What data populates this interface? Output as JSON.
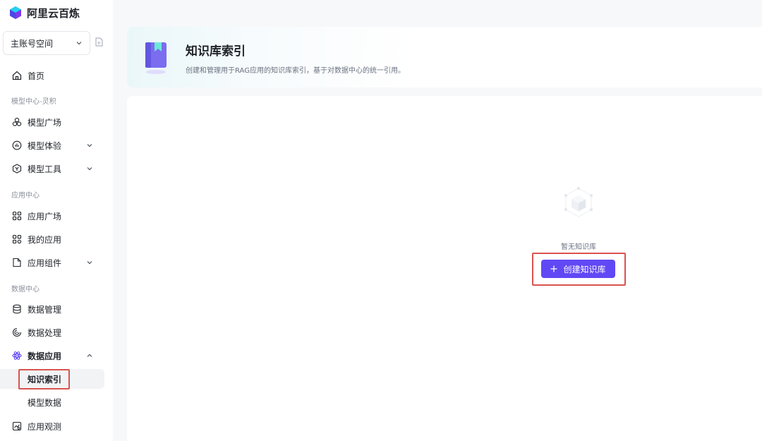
{
  "app": {
    "name": "阿里云百炼"
  },
  "workspace": {
    "label": "主账号空间"
  },
  "sidebar": {
    "home": "首页",
    "sections": [
      {
        "label": "模型中心-灵积",
        "items": [
          "模型广场",
          "模型体验",
          "模型工具"
        ]
      },
      {
        "label": "应用中心",
        "items": [
          "应用广场",
          "我的应用",
          "应用组件"
        ]
      },
      {
        "label": "数据中心",
        "items": [
          "数据管理",
          "数据处理",
          "数据应用"
        ]
      }
    ],
    "data_app_children": [
      "知识索引",
      "模型数据"
    ],
    "last_item": "应用观测"
  },
  "header": {
    "title": "知识库索引",
    "description": "创建和管理用于RAG应用的知识库索引，基于对数据中心的统一引用。"
  },
  "empty_state": {
    "text": "暂无知识库",
    "button_label": "创建知识库"
  },
  "colors": {
    "accent": "#6148f5",
    "highlight_box": "#d9534f"
  }
}
